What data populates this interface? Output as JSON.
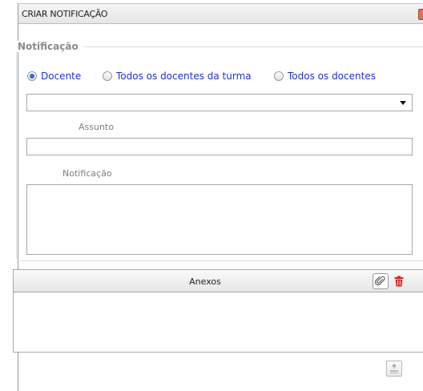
{
  "dialog": {
    "title": "CRIAR NOTIFICAÇÃO"
  },
  "section": {
    "legend": "Notificação"
  },
  "recipients": {
    "options": [
      {
        "label": "Docente",
        "checked": true
      },
      {
        "label": "Todos os docentes da turma",
        "checked": false
      },
      {
        "label": "Todos os docentes",
        "checked": false
      }
    ]
  },
  "form": {
    "select_value": "",
    "subject_label": "Assunto",
    "subject_value": "",
    "message_label": "Notificação",
    "message_value": ""
  },
  "attachments": {
    "header": "Anexos"
  },
  "icons": {
    "close": "close-icon",
    "attach": "paperclip-icon",
    "delete": "trash-icon",
    "save": "save-icon"
  },
  "colors": {
    "radio_label": "#1f2fe0",
    "checked_radio": "#2e6fcf",
    "delete_icon": "#e01b1b"
  }
}
